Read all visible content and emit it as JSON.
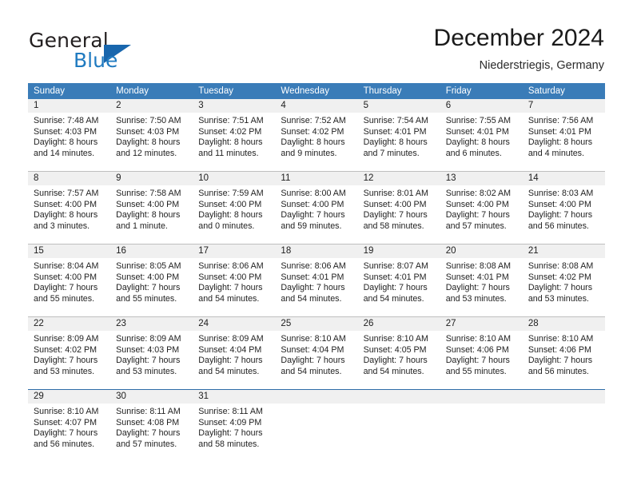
{
  "brand": {
    "name_top": "General",
    "name_bottom": "Blue",
    "triangle_color": "#1866ad",
    "blue_color": "#1f7ac0"
  },
  "header": {
    "title": "December 2024",
    "subtitle": "Niederstriegis, Germany"
  },
  "theme": {
    "header_blue": "#3a7cb8",
    "day_band_gray": "#f0f0f0",
    "divider_gray": "#bfbfbf",
    "last_row_border": "#2f6ca8"
  },
  "calendar": {
    "weekdays": [
      "Sunday",
      "Monday",
      "Tuesday",
      "Wednesday",
      "Thursday",
      "Friday",
      "Saturday"
    ],
    "weeks": [
      {
        "days": [
          {
            "num": "1",
            "sunrise": "Sunrise: 7:48 AM",
            "sunset": "Sunset: 4:03 PM",
            "daylight1": "Daylight: 8 hours",
            "daylight2": "and 14 minutes."
          },
          {
            "num": "2",
            "sunrise": "Sunrise: 7:50 AM",
            "sunset": "Sunset: 4:03 PM",
            "daylight1": "Daylight: 8 hours",
            "daylight2": "and 12 minutes."
          },
          {
            "num": "3",
            "sunrise": "Sunrise: 7:51 AM",
            "sunset": "Sunset: 4:02 PM",
            "daylight1": "Daylight: 8 hours",
            "daylight2": "and 11 minutes."
          },
          {
            "num": "4",
            "sunrise": "Sunrise: 7:52 AM",
            "sunset": "Sunset: 4:02 PM",
            "daylight1": "Daylight: 8 hours",
            "daylight2": "and 9 minutes."
          },
          {
            "num": "5",
            "sunrise": "Sunrise: 7:54 AM",
            "sunset": "Sunset: 4:01 PM",
            "daylight1": "Daylight: 8 hours",
            "daylight2": "and 7 minutes."
          },
          {
            "num": "6",
            "sunrise": "Sunrise: 7:55 AM",
            "sunset": "Sunset: 4:01 PM",
            "daylight1": "Daylight: 8 hours",
            "daylight2": "and 6 minutes."
          },
          {
            "num": "7",
            "sunrise": "Sunrise: 7:56 AM",
            "sunset": "Sunset: 4:01 PM",
            "daylight1": "Daylight: 8 hours",
            "daylight2": "and 4 minutes."
          }
        ]
      },
      {
        "days": [
          {
            "num": "8",
            "sunrise": "Sunrise: 7:57 AM",
            "sunset": "Sunset: 4:00 PM",
            "daylight1": "Daylight: 8 hours",
            "daylight2": "and 3 minutes."
          },
          {
            "num": "9",
            "sunrise": "Sunrise: 7:58 AM",
            "sunset": "Sunset: 4:00 PM",
            "daylight1": "Daylight: 8 hours",
            "daylight2": "and 1 minute."
          },
          {
            "num": "10",
            "sunrise": "Sunrise: 7:59 AM",
            "sunset": "Sunset: 4:00 PM",
            "daylight1": "Daylight: 8 hours",
            "daylight2": "and 0 minutes."
          },
          {
            "num": "11",
            "sunrise": "Sunrise: 8:00 AM",
            "sunset": "Sunset: 4:00 PM",
            "daylight1": "Daylight: 7 hours",
            "daylight2": "and 59 minutes."
          },
          {
            "num": "12",
            "sunrise": "Sunrise: 8:01 AM",
            "sunset": "Sunset: 4:00 PM",
            "daylight1": "Daylight: 7 hours",
            "daylight2": "and 58 minutes."
          },
          {
            "num": "13",
            "sunrise": "Sunrise: 8:02 AM",
            "sunset": "Sunset: 4:00 PM",
            "daylight1": "Daylight: 7 hours",
            "daylight2": "and 57 minutes."
          },
          {
            "num": "14",
            "sunrise": "Sunrise: 8:03 AM",
            "sunset": "Sunset: 4:00 PM",
            "daylight1": "Daylight: 7 hours",
            "daylight2": "and 56 minutes."
          }
        ]
      },
      {
        "days": [
          {
            "num": "15",
            "sunrise": "Sunrise: 8:04 AM",
            "sunset": "Sunset: 4:00 PM",
            "daylight1": "Daylight: 7 hours",
            "daylight2": "and 55 minutes."
          },
          {
            "num": "16",
            "sunrise": "Sunrise: 8:05 AM",
            "sunset": "Sunset: 4:00 PM",
            "daylight1": "Daylight: 7 hours",
            "daylight2": "and 55 minutes."
          },
          {
            "num": "17",
            "sunrise": "Sunrise: 8:06 AM",
            "sunset": "Sunset: 4:00 PM",
            "daylight1": "Daylight: 7 hours",
            "daylight2": "and 54 minutes."
          },
          {
            "num": "18",
            "sunrise": "Sunrise: 8:06 AM",
            "sunset": "Sunset: 4:01 PM",
            "daylight1": "Daylight: 7 hours",
            "daylight2": "and 54 minutes."
          },
          {
            "num": "19",
            "sunrise": "Sunrise: 8:07 AM",
            "sunset": "Sunset: 4:01 PM",
            "daylight1": "Daylight: 7 hours",
            "daylight2": "and 54 minutes."
          },
          {
            "num": "20",
            "sunrise": "Sunrise: 8:08 AM",
            "sunset": "Sunset: 4:01 PM",
            "daylight1": "Daylight: 7 hours",
            "daylight2": "and 53 minutes."
          },
          {
            "num": "21",
            "sunrise": "Sunrise: 8:08 AM",
            "sunset": "Sunset: 4:02 PM",
            "daylight1": "Daylight: 7 hours",
            "daylight2": "and 53 minutes."
          }
        ]
      },
      {
        "days": [
          {
            "num": "22",
            "sunrise": "Sunrise: 8:09 AM",
            "sunset": "Sunset: 4:02 PM",
            "daylight1": "Daylight: 7 hours",
            "daylight2": "and 53 minutes."
          },
          {
            "num": "23",
            "sunrise": "Sunrise: 8:09 AM",
            "sunset": "Sunset: 4:03 PM",
            "daylight1": "Daylight: 7 hours",
            "daylight2": "and 53 minutes."
          },
          {
            "num": "24",
            "sunrise": "Sunrise: 8:09 AM",
            "sunset": "Sunset: 4:04 PM",
            "daylight1": "Daylight: 7 hours",
            "daylight2": "and 54 minutes."
          },
          {
            "num": "25",
            "sunrise": "Sunrise: 8:10 AM",
            "sunset": "Sunset: 4:04 PM",
            "daylight1": "Daylight: 7 hours",
            "daylight2": "and 54 minutes."
          },
          {
            "num": "26",
            "sunrise": "Sunrise: 8:10 AM",
            "sunset": "Sunset: 4:05 PM",
            "daylight1": "Daylight: 7 hours",
            "daylight2": "and 54 minutes."
          },
          {
            "num": "27",
            "sunrise": "Sunrise: 8:10 AM",
            "sunset": "Sunset: 4:06 PM",
            "daylight1": "Daylight: 7 hours",
            "daylight2": "and 55 minutes."
          },
          {
            "num": "28",
            "sunrise": "Sunrise: 8:10 AM",
            "sunset": "Sunset: 4:06 PM",
            "daylight1": "Daylight: 7 hours",
            "daylight2": "and 56 minutes."
          }
        ]
      },
      {
        "days": [
          {
            "num": "29",
            "sunrise": "Sunrise: 8:10 AM",
            "sunset": "Sunset: 4:07 PM",
            "daylight1": "Daylight: 7 hours",
            "daylight2": "and 56 minutes."
          },
          {
            "num": "30",
            "sunrise": "Sunrise: 8:11 AM",
            "sunset": "Sunset: 4:08 PM",
            "daylight1": "Daylight: 7 hours",
            "daylight2": "and 57 minutes."
          },
          {
            "num": "31",
            "sunrise": "Sunrise: 8:11 AM",
            "sunset": "Sunset: 4:09 PM",
            "daylight1": "Daylight: 7 hours",
            "daylight2": "and 58 minutes."
          },
          {
            "num": "",
            "sunrise": "",
            "sunset": "",
            "daylight1": "",
            "daylight2": ""
          },
          {
            "num": "",
            "sunrise": "",
            "sunset": "",
            "daylight1": "",
            "daylight2": ""
          },
          {
            "num": "",
            "sunrise": "",
            "sunset": "",
            "daylight1": "",
            "daylight2": ""
          },
          {
            "num": "",
            "sunrise": "",
            "sunset": "",
            "daylight1": "",
            "daylight2": ""
          }
        ]
      }
    ]
  }
}
